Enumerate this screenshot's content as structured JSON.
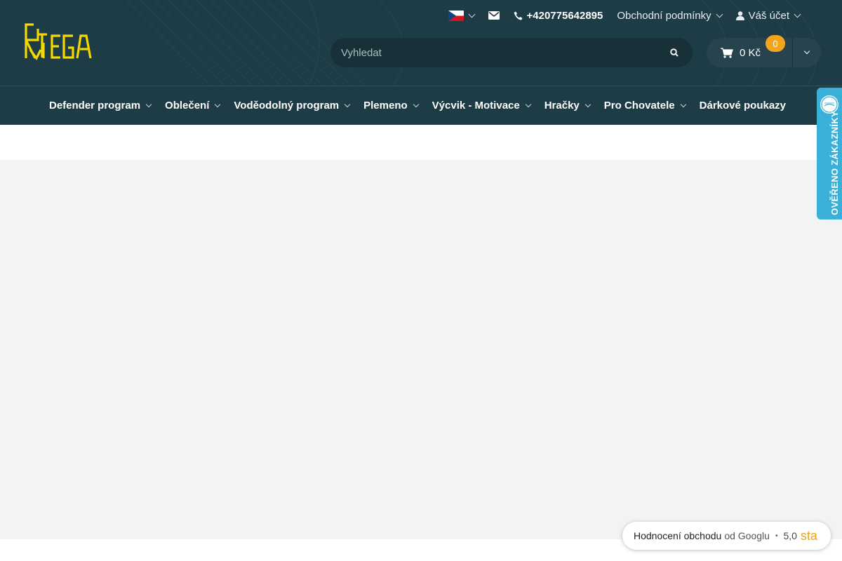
{
  "header": {
    "logo_text": "RITEGA",
    "language": {
      "selected": "CZ",
      "icon": "czech-flag-icon"
    },
    "email_icon": "envelope-icon",
    "phone": "+420775642895",
    "terms_label": "Obchodní podmínky",
    "account_label": "Váš účet"
  },
  "search": {
    "placeholder": "Vyhledat",
    "value": ""
  },
  "cart": {
    "total": "0 Kč",
    "count": "0"
  },
  "nav": {
    "items": [
      {
        "label": "Defender program",
        "has_dropdown": true
      },
      {
        "label": "Oblečení",
        "has_dropdown": true
      },
      {
        "label": "Voděodolný program",
        "has_dropdown": true
      },
      {
        "label": "Plemeno",
        "has_dropdown": true
      },
      {
        "label": "Výcvik - Motivace",
        "has_dropdown": true
      },
      {
        "label": "Hračky",
        "has_dropdown": true
      },
      {
        "label": "Pro Chovatele",
        "has_dropdown": true
      },
      {
        "label": "Dárkové poukazy",
        "has_dropdown": false
      }
    ]
  },
  "verified_widget": {
    "label": "OVĚŘENO ZÁKAZNÍKY"
  },
  "rating_widget": {
    "label": "Hodnocení obchodu",
    "source": "od Googlu",
    "separator": "•",
    "score": "5,0",
    "stars": "sta"
  },
  "colors": {
    "header_bg": "#1e3c46",
    "accent_yellow": "#f5d800",
    "badge_orange": "#f2a51a",
    "verified_blue": "#3ab0d8",
    "content_bg": "#f1f3f5"
  }
}
